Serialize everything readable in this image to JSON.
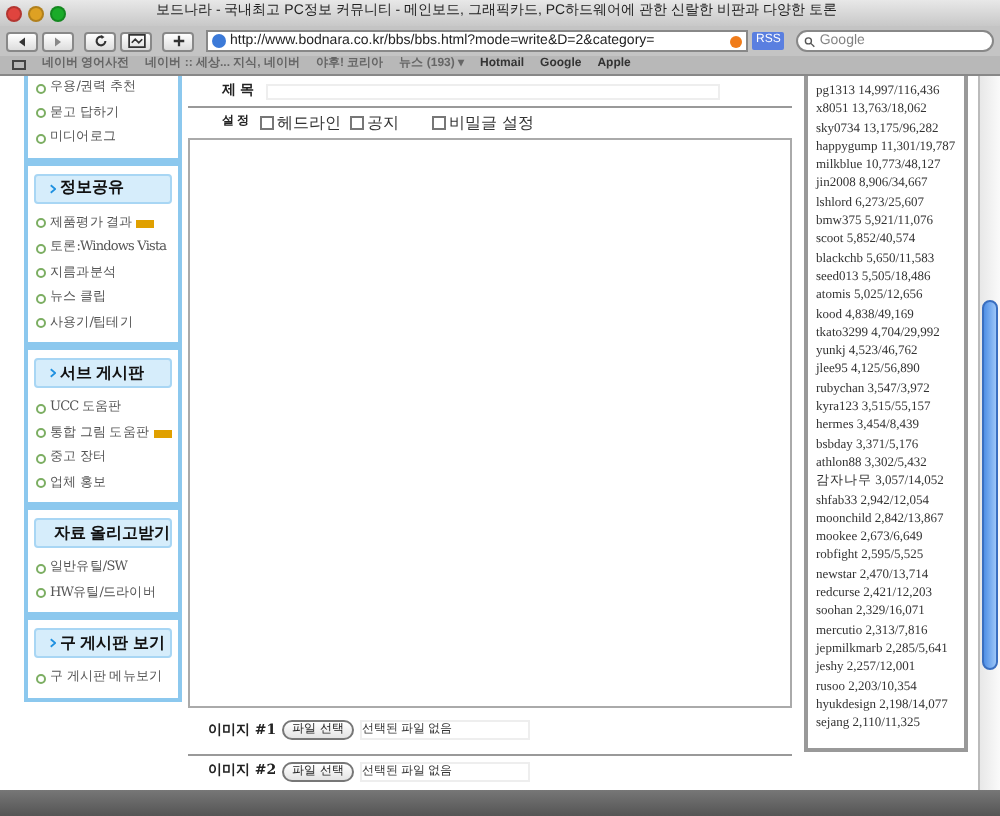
{
  "window": {
    "title": "보드나라 - 국내최고 PC정보 커뮤니티 - 메인보드, 그래픽카드, PC하드웨어에 관한 신랄한 비판과 다양한 토론"
  },
  "toolbar": {
    "url": "http://www.bodnara.co.kr/bbs/bbs.html?mode=write&D=2&category=",
    "rss": "RSS",
    "search": {
      "placeholder": "Google"
    }
  },
  "bookmarks": [
    "네이버 영어사전",
    "네이버 :: 세상... 지식, 네이버",
    "야후! 코리아",
    "뉴스 (193) ▾",
    "Hotmail",
    "Google",
    "Apple"
  ],
  "sidebar": {
    "sections": [
      {
        "items": [
          {
            "label": "우용/권력 추천",
            "new": false
          },
          {
            "label": "묻고 답하기",
            "new": false
          },
          {
            "label": "미디어로그",
            "new": false
          }
        ]
      },
      {
        "title": "정보공유",
        "items": [
          {
            "label": "제품평가 결과",
            "new": true
          },
          {
            "label": "토론:Windows Vista",
            "new": false
          },
          {
            "label": "지름과분석",
            "new": false
          },
          {
            "label": "뉴스 클립",
            "new": false
          },
          {
            "label": "사용기/팁테기",
            "new": false
          }
        ]
      },
      {
        "title": "서브 게시판",
        "items": [
          {
            "label": "UCC 도움판",
            "new": false
          },
          {
            "label": "통합 그림 도움판",
            "new": true
          },
          {
            "label": "중고 장터",
            "new": false
          },
          {
            "label": "업체 홍보",
            "new": false
          }
        ]
      },
      {
        "title": "자료 올리고받기",
        "items": [
          {
            "label": "일반유틸/SW",
            "new": false
          },
          {
            "label": "HW유틸/드라이버",
            "new": false
          }
        ]
      },
      {
        "title": "구 게시판 보기",
        "items": [
          {
            "label": "구 게시판 메뉴보기",
            "new": false
          }
        ]
      }
    ]
  },
  "form": {
    "subject_label": "제 목",
    "settings_label": "설 정",
    "options": [
      {
        "label": "헤드라인",
        "checked": false
      },
      {
        "label": "공지",
        "checked": false
      },
      {
        "label": "비밀글 설정",
        "checked": false
      }
    ],
    "images": [
      {
        "label": "이미지 #1",
        "button": "파일 선택",
        "status": "선택된 파일 없음"
      },
      {
        "label": "이미지 #2",
        "button": "파일 선택",
        "status": "선택된 파일 없음"
      }
    ]
  },
  "ranking": [
    "pg1313 14,997/116,436",
    "x8051 13,763/18,062",
    "sky0734 13,175/96,282",
    "happygump 11,301/19,787",
    "milkblue 10,773/48,127",
    "jin2008 8,906/34,667",
    "lshlord 6,273/25,607",
    "bmw375 5,921/11,076",
    "scoot 5,852/40,574",
    "blackchb 5,650/11,583",
    "seed013 5,505/18,486",
    "atomis 5,025/12,656",
    "kood 4,838/49,169",
    "tkato3299 4,704/29,992",
    "yunkj 4,523/46,762",
    "jlee95 4,125/56,890",
    "rubychan 3,547/3,972",
    "kyra123 3,515/55,157",
    "hermes 3,454/8,439",
    "bsbday 3,371/5,176",
    "athlon88 3,302/5,432",
    "감자나무 3,057/14,052",
    "shfab33 2,942/12,054",
    "moonchild 2,842/13,867",
    "mookee 2,673/6,649",
    "robfight 2,595/5,525",
    "newstar 2,470/13,714",
    "redcurse 2,421/12,203",
    "soohan 2,329/16,071",
    "mercutio 2,313/7,816",
    "jepmilkmarb 2,285/5,641",
    "jeshy 2,257/12,001",
    "rusoo 2,203/10,354",
    "hyukdesign 2,198/14,077",
    "sejang 2,110/11,325"
  ]
}
